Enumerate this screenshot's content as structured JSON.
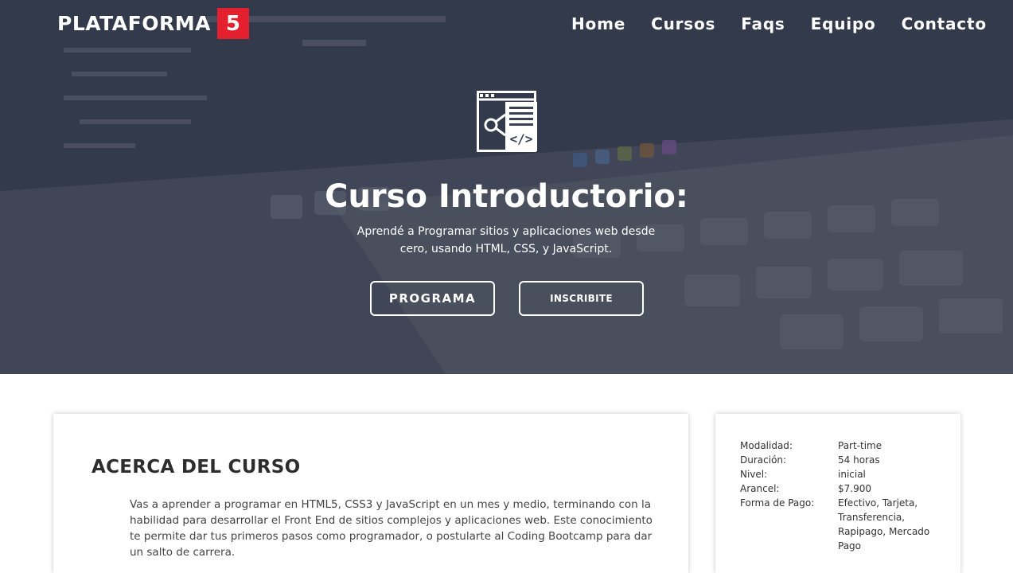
{
  "header": {
    "logo_text": "PLATAFORMA",
    "logo_number": "5",
    "brand_color": "#e4202e",
    "nav": [
      {
        "label": "Home"
      },
      {
        "label": "Cursos"
      },
      {
        "label": "Faqs"
      },
      {
        "label": "Equipo"
      },
      {
        "label": "Contacto"
      }
    ]
  },
  "hero": {
    "icon": "code-window-icon",
    "title": "Curso Introductorio:",
    "subtitle": "Aprendé a Programar sitios y aplicaciones web desde cero, usando HTML, CSS, y JavaScript.",
    "buttons": {
      "programa": "PROGRAMA",
      "inscribite": "INSCRIBITE"
    }
  },
  "about": {
    "title": "ACERCA DEL CURSO",
    "text": "Vas a aprender a programar en HTML5, CSS3 y JavaScript en un mes y medio, terminando con la habilidad para desarrollar el Front End de sitios complejos y aplicaciones web. Este conocimiento te permite dar tus primeros pasos como programador, o postularte al Coding Bootcamp para dar un salto de carrera."
  },
  "info": {
    "rows": [
      {
        "label": "Modalidad:",
        "value": "Part-time"
      },
      {
        "label": "Duración:",
        "value": "54 horas"
      },
      {
        "label": "Nivel:",
        "value": "inicial"
      },
      {
        "label": "Arancel:",
        "value": "$7.900"
      },
      {
        "label": "Forma de Pago:",
        "value": "Efectivo, Tarjeta, Transferencia, Rapipago, Mercado Pago"
      }
    ]
  }
}
